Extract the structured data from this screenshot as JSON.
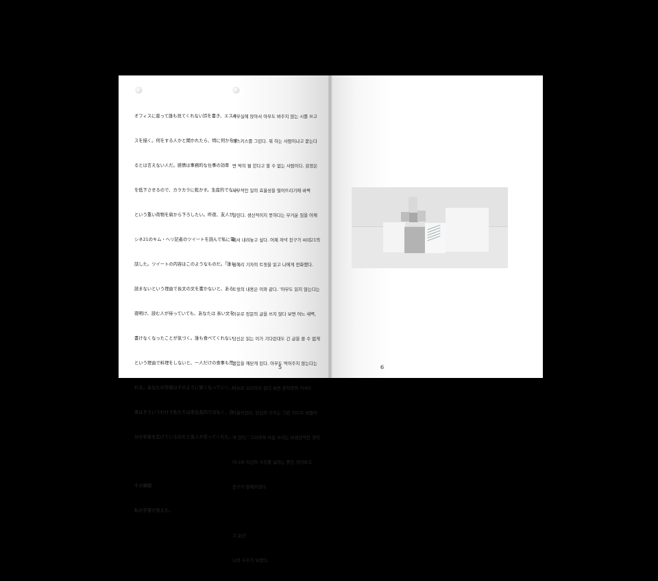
{
  "left_page": {
    "paragraph_lines": [
      "オフィスに座って誰も見てくれない詩を書き、エスキ",
      "スを描く。何をする人かと聞かれたら、特に何かをす",
      "るとは言えない人だ。感情は事務的な仕事の効率",
      "を低下させるので、カラカラに乾かす。生産的でない",
      "という重い荷物を肩から下ろしたい。昨夜、友人が",
      "シネ21のキム・ヘリ記者のツイートを読んで私に電",
      "話した。ツイートの内容はこのようなものだ。「誰も",
      "読まないという理由で長文の文を書かないと、ある",
      "夜明け、読む人が待っていても、あなたは 長い文を",
      "書けなくなったことが気づく。誰も食べてくれない",
      "という理由で料理をしないと、一人だけの食事も荒",
      "れる。あなたの宇宙はそのように狭くなっていく。」",
      "実はそういうわけで私たちは非生産的ではなく、自",
      "分の宇宙を広げているのだと友人が言ってくれた。"
    ],
    "closing_lines": [
      "その瞬間",
      "私の宇宙が見えた。"
    ],
    "page_number": "5"
  },
  "middle_column": {
    "paragraph_lines": [
      "사무실에 앉아서 아무도 봐주지 않는 시를 쓰고",
      "에스키스를 그린다. 뭐 하는 사람이냐고 묻는다",
      "면 딱히 뭘 한다고 할 수 없는 사람이다. 감정은",
      "사무적인 일의 효율성을 떨어뜨리기에 바짝",
      "말린다. 생산적이지 못하다는 무거운 짐을 어깨",
      "에서 내려놓고 싶다. 어제 저녁 친구가 씨네21의",
      "김혜리 기자의 트윗을 읽고 나에게 전화했다.",
      "트윗의 내용은 이와 같다. '아무도 읽지 않는다는",
      "이유로 장문의 글을 쓰지 않다 보면 어느 새벽,",
      "당신은 읽는 이가 기다린대도 긴 글을 쓸 수 없게",
      "됐음을 깨닫게 된다. 아무도 먹어주지 않는다는",
      "이유로 요리하지 않다 보면 혼자만의 식사도",
      "거칠어진다. 당신의 우주는 그런 식으로 비좁아",
      "져 간다.' 그리하여 사실 우리는 비생산적인 것이",
      "아니라 자신의 우주를 넓히는 중인 것이라고",
      "친구가 말해주었다."
    ],
    "closing_lines": [
      "그 순간",
      "나의 우주가 보였다."
    ]
  },
  "right_page": {
    "page_number": "6"
  }
}
